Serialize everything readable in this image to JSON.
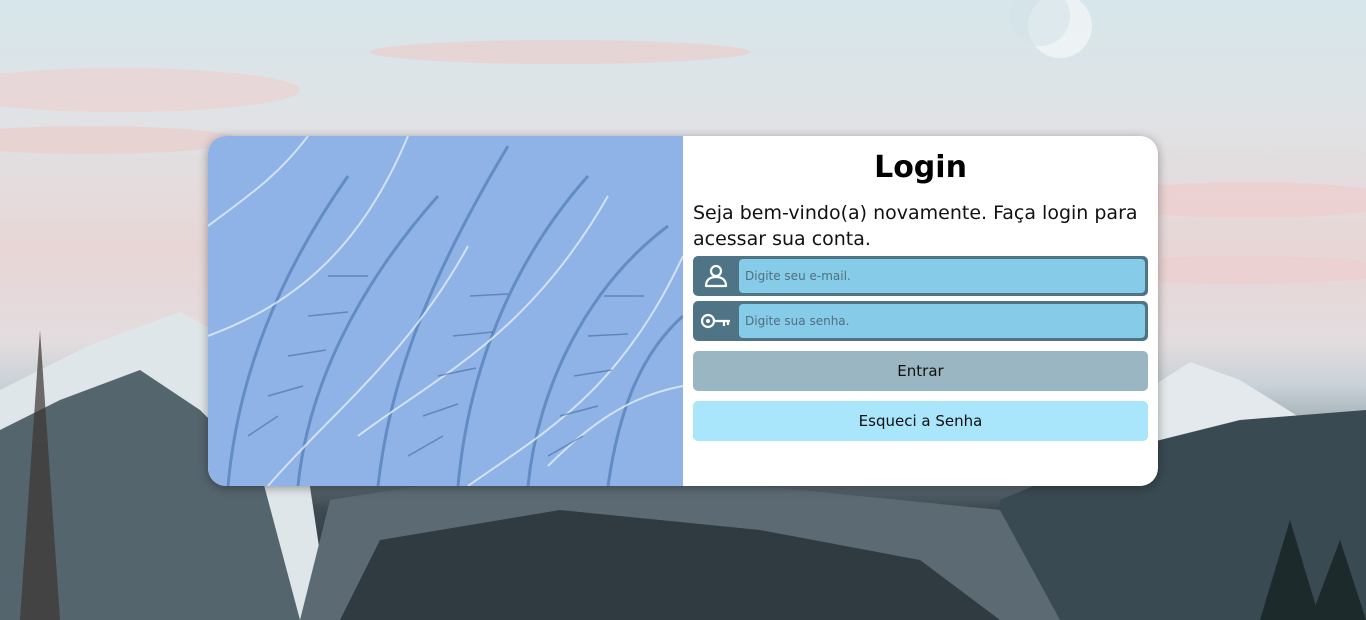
{
  "login": {
    "title": "Login",
    "welcome": "Seja bem-vindo(a) novamente. Faça login para acessar sua conta.",
    "email": {
      "placeholder": "Digite seu e-mail.",
      "icon": "user-icon"
    },
    "password": {
      "placeholder": "Digite sua senha.",
      "icon": "key-icon"
    },
    "enter_label": "Entrar",
    "forgot_label": "Esqueci a Senha"
  },
  "colors": {
    "card": "#ffffff",
    "field_icon_bg": "#4e7486",
    "field_input_bg": "#86cce8",
    "enter_button": "#9ab6c3",
    "forgot_button": "#a9e5fb"
  }
}
